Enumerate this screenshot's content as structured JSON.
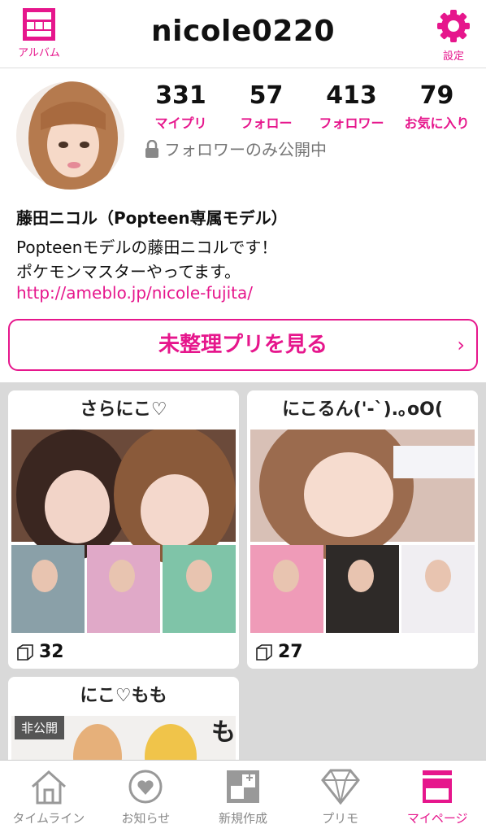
{
  "header": {
    "album_label": "アルバム",
    "title": "nicole0220",
    "settings_label": "設定"
  },
  "profile": {
    "stats": [
      {
        "value": "331",
        "label": "マイプリ"
      },
      {
        "value": "57",
        "label": "フォロー"
      },
      {
        "value": "413",
        "label": "フォロワー"
      },
      {
        "value": "79",
        "label": "お気に入り"
      }
    ],
    "privacy_text": "フォロワーのみ公開中",
    "name": "藤田ニコル（Popteen専属モデル）",
    "bio_line1": "Popteenモデルの藤田ニコルです！",
    "bio_line2": "ポケモンマスターやってます。",
    "link": "http://ameblo.jp/nicole-fujita/"
  },
  "unsorted_button": "未整理プリを見る",
  "albums": [
    {
      "title": "さらにこ♡",
      "count": "32"
    },
    {
      "title": "にこるん('-`).｡oO(",
      "count": "27"
    },
    {
      "title": "にこ♡もも",
      "badge": "非公開"
    }
  ],
  "nav": [
    {
      "label": "タイムライン",
      "icon": "house-icon"
    },
    {
      "label": "お知らせ",
      "icon": "heart-bubble-icon"
    },
    {
      "label": "新規作成",
      "icon": "new-grid-icon"
    },
    {
      "label": "プリモ",
      "icon": "diamond-icon"
    },
    {
      "label": "マイページ",
      "icon": "mypage-icon"
    }
  ],
  "colors": {
    "accent": "#e6168c",
    "gallery_bg": "#d9d9d9"
  }
}
